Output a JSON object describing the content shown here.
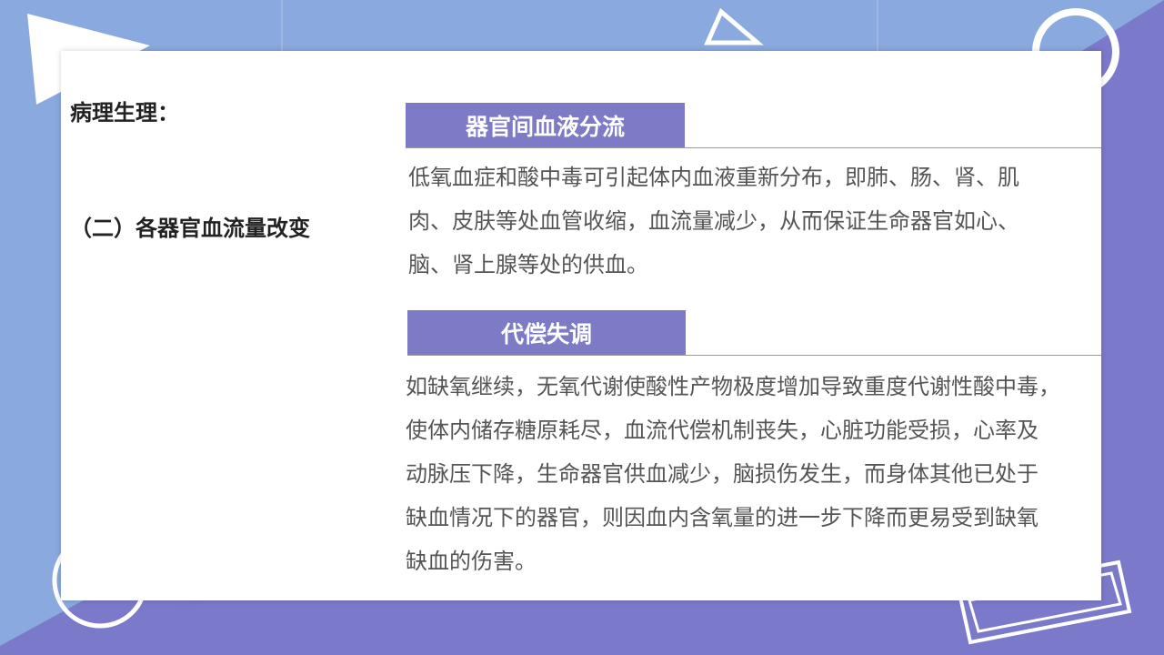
{
  "colors": {
    "background_light": "#8aa9de",
    "background_purple": "#7b79c9",
    "accent": "#7d7ac6",
    "white": "#ffffff"
  },
  "sidebar": {
    "title": "病理生理：",
    "subtitle": "（二）各器官血流量改变"
  },
  "sections": [
    {
      "heading": "器官间血液分流",
      "lines": [
        "低氧血症和酸中毒可引起体内血液重新分布，即肺、肠、肾、肌",
        "肉、皮肤等处血管收缩，血流量减少，从而保证生命器官如心、",
        "脑、肾上腺等处的供血。"
      ]
    },
    {
      "heading": "代偿失调",
      "lines": [
        "如缺氧继续，无氧代谢使酸性产物极度增加导致重度代谢性酸中毒，",
        "使体内储存糖原耗尽，血流代偿机制丧失，心脏功能受损，心率及",
        "动脉压下降，生命器官供血减少，脑损伤发生，而身体其他已处于",
        "缺血情况下的器官，则因血内含氧量的进一步下降而更易受到缺氧",
        "缺血的伤害。"
      ]
    }
  ]
}
